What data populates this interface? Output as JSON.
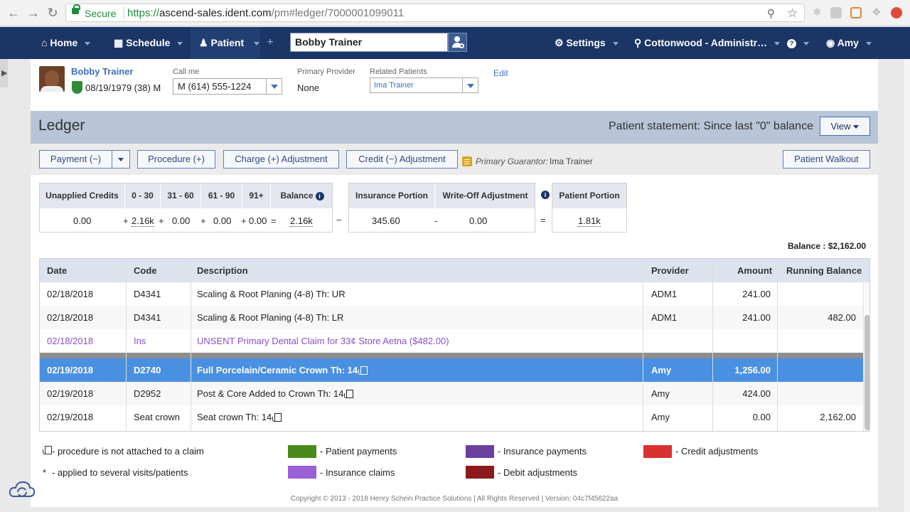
{
  "browser": {
    "secure_label": "Secure",
    "url_scheme": "https://",
    "url_host": "ascend-sales.ident.com",
    "url_path": "/pm#ledger/7000001099011"
  },
  "nav": {
    "home": "Home",
    "schedule": "Schedule",
    "patient": "Patient",
    "patient_search_value": "Bobby Trainer",
    "settings": "Settings",
    "location": "Cottonwood - Administr…",
    "help": "?",
    "user": "Amy"
  },
  "patient": {
    "name": "Bobby Trainer",
    "dob": "08/19/1979 (38) M",
    "call_me_label": "Call me",
    "call_me_value": "M (614) 555-1224",
    "provider_label": "Primary Provider",
    "provider_value": "None",
    "related_label": "Related Patients",
    "related_value": "Ima Trainer",
    "edit": "Edit"
  },
  "ledger": {
    "title": "Ledger",
    "statement": "Patient statement: Since last \"0\" balance",
    "view_button": "View",
    "toolbar": {
      "payment": "Payment (−)",
      "procedure": "Procedure (+)",
      "charge_adj": "Charge (+) Adjustment",
      "credit_adj": "Credit (−) Adjustment",
      "guarantor_label": "Primary Guarantor:",
      "guarantor_value": "Ima Trainer",
      "walkout": "Patient Walkout"
    },
    "aging": {
      "headers": [
        "Unapplied Credits",
        "0 - 30",
        "31 - 60",
        "61 - 90",
        "91+",
        "Balance"
      ],
      "unapplied": "0.00",
      "d0_30": "2.16k",
      "d31_60": "0.00",
      "d61_90": "0.00",
      "d91": "0.00",
      "balance": "2.16k",
      "ops": [
        "+",
        "+",
        "+",
        "+",
        "="
      ]
    },
    "insurance": {
      "headers": [
        "Insurance Portion",
        "Write-Off Adjustment"
      ],
      "portion": "345.60",
      "writeoff": "0.00",
      "op_minus": "−",
      "op_dash": "-",
      "op_eq": "="
    },
    "patient_portion": {
      "header": "Patient Portion",
      "value": "1.81k"
    },
    "balance_text": "Balance : $2,162.00",
    "table": {
      "headers": [
        "Date",
        "Code",
        "Description",
        "Provider",
        "Amount",
        "Running Balance"
      ],
      "rows": [
        {
          "date": "02/18/2018",
          "code": "D4341",
          "desc": "Scaling & Root Planing (4-8) Th: UR",
          "provider": "ADM1",
          "amount": "241.00",
          "running": ""
        },
        {
          "date": "02/18/2018",
          "code": "D4341",
          "desc": "Scaling & Root Planing (4-8) Th: LR",
          "provider": "ADM1",
          "amount": "241.00",
          "running": "482.00"
        },
        {
          "date": "02/18/2018",
          "code": "Ins",
          "desc": "UNSENT Primary Dental Claim for 33¢ Store Aetna ($482.00)",
          "provider": "",
          "amount": "",
          "running": ""
        },
        {
          "date": "02/19/2018",
          "code": "D2740",
          "desc": "Full Porcelain/Ceramic Crown Th: 14",
          "provider": "Amy",
          "amount": "1,256.00",
          "running": ""
        },
        {
          "date": "02/19/2018",
          "code": "D2952",
          "desc": "Post & Core Added to Crown Th: 14",
          "provider": "Amy",
          "amount": "424.00",
          "running": ""
        },
        {
          "date": "02/19/2018",
          "code": "Seat crown",
          "desc": "Seat crown Th: 14",
          "provider": "Amy",
          "amount": "0.00",
          "running": "2,162.00"
        }
      ]
    }
  },
  "legend": {
    "not_attached": "- procedure is not attached to a claim",
    "applied_star": "*",
    "applied": "- applied to several visits/patients",
    "patient_payments": "- Patient payments",
    "insurance_claims": "- Insurance claims",
    "insurance_payments": "- Insurance payments",
    "debit_adjustments": "- Debit adjustments",
    "credit_adjustments": "- Credit adjustments",
    "colors": {
      "patient_payments": "#4a8a1c",
      "insurance_claims": "#9b5fd6",
      "insurance_payments": "#6b3fa0",
      "debit_adjustments": "#8b1a1a",
      "credit_adjustments": "#d93030"
    }
  },
  "footer": "Copyright © 2013 - 2018 Henry Schein Practice Solutions | All Rights Reserved | Version: 04c7f45622aa"
}
